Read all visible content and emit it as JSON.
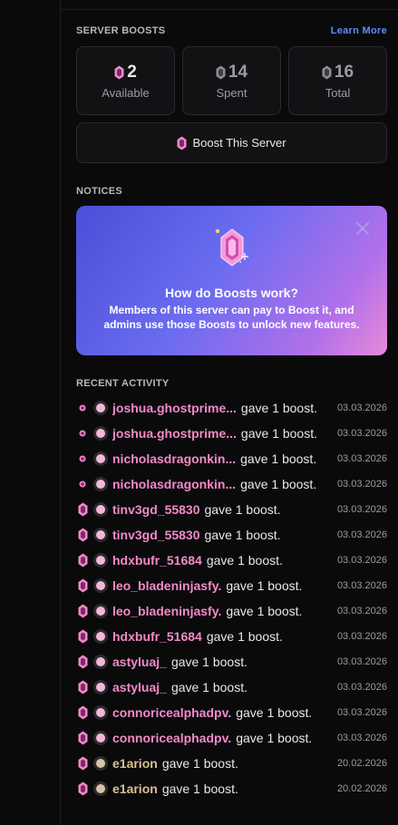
{
  "boosts": {
    "section_title": "SERVER BOOSTS",
    "learn_more": "Learn More",
    "stats": [
      {
        "value": "2",
        "label": "Available"
      },
      {
        "value": "14",
        "label": "Spent"
      },
      {
        "value": "16",
        "label": "Total"
      }
    ],
    "boost_button": "Boost This Server"
  },
  "notices": {
    "section_title": "NOTICES",
    "card_title": "How do Boosts work?",
    "card_body": "Members of this server can pay to Boost it, and admins use those Boosts to unlock new features."
  },
  "activity": {
    "section_title": "RECENT ACTIVITY",
    "items": [
      {
        "user": "joshua.ghostprime...",
        "action": "gave 1 boost.",
        "date": "03.03.2026"
      },
      {
        "user": "joshua.ghostprime...",
        "action": "gave 1 boost.",
        "date": "03.03.2026"
      },
      {
        "user": "nicholasdragonkin...",
        "action": "gave 1 boost.",
        "date": "03.03.2026"
      },
      {
        "user": "nicholasdragonkin...",
        "action": "gave 1 boost.",
        "date": "03.03.2026"
      },
      {
        "user": "tinv3gd_55830",
        "action": "gave 1 boost.",
        "date": "03.03.2026"
      },
      {
        "user": "tinv3gd_55830",
        "action": "gave 1 boost.",
        "date": "03.03.2026"
      },
      {
        "user": "hdxbufr_51684",
        "action": "gave 1 boost.",
        "date": "03.03.2026"
      },
      {
        "user": "leo_bladeninjasfy.",
        "action": "gave 1 boost.",
        "date": "03.03.2026"
      },
      {
        "user": "leo_bladeninjasfy.",
        "action": "gave 1 boost.",
        "date": "03.03.2026"
      },
      {
        "user": "hdxbufr_51684",
        "action": "gave 1 boost.",
        "date": "03.03.2026"
      },
      {
        "user": "astyluaj_",
        "action": "gave 1 boost.",
        "date": "03.03.2026"
      },
      {
        "user": "astyluaj_",
        "action": "gave 1 boost.",
        "date": "03.03.2026"
      },
      {
        "user": "connoricealphadpv.",
        "action": "gave 1 boost.",
        "date": "03.03.2026"
      },
      {
        "user": "connoricealphadpv.",
        "action": "gave 1 boost.",
        "date": "03.03.2026"
      },
      {
        "user": "e1arion",
        "action": "gave 1 boost.",
        "date": "20.02.2026"
      },
      {
        "user": "e1arion",
        "action": "gave 1 boost.",
        "date": "20.02.2026"
      }
    ]
  },
  "colors": {
    "accent_pink": "#f28ac8",
    "link_blue": "#5b8dff",
    "tan_user": "#d9c08f"
  },
  "icons": {
    "boost_gem": "boost-gem-icon",
    "close": "close-icon"
  }
}
